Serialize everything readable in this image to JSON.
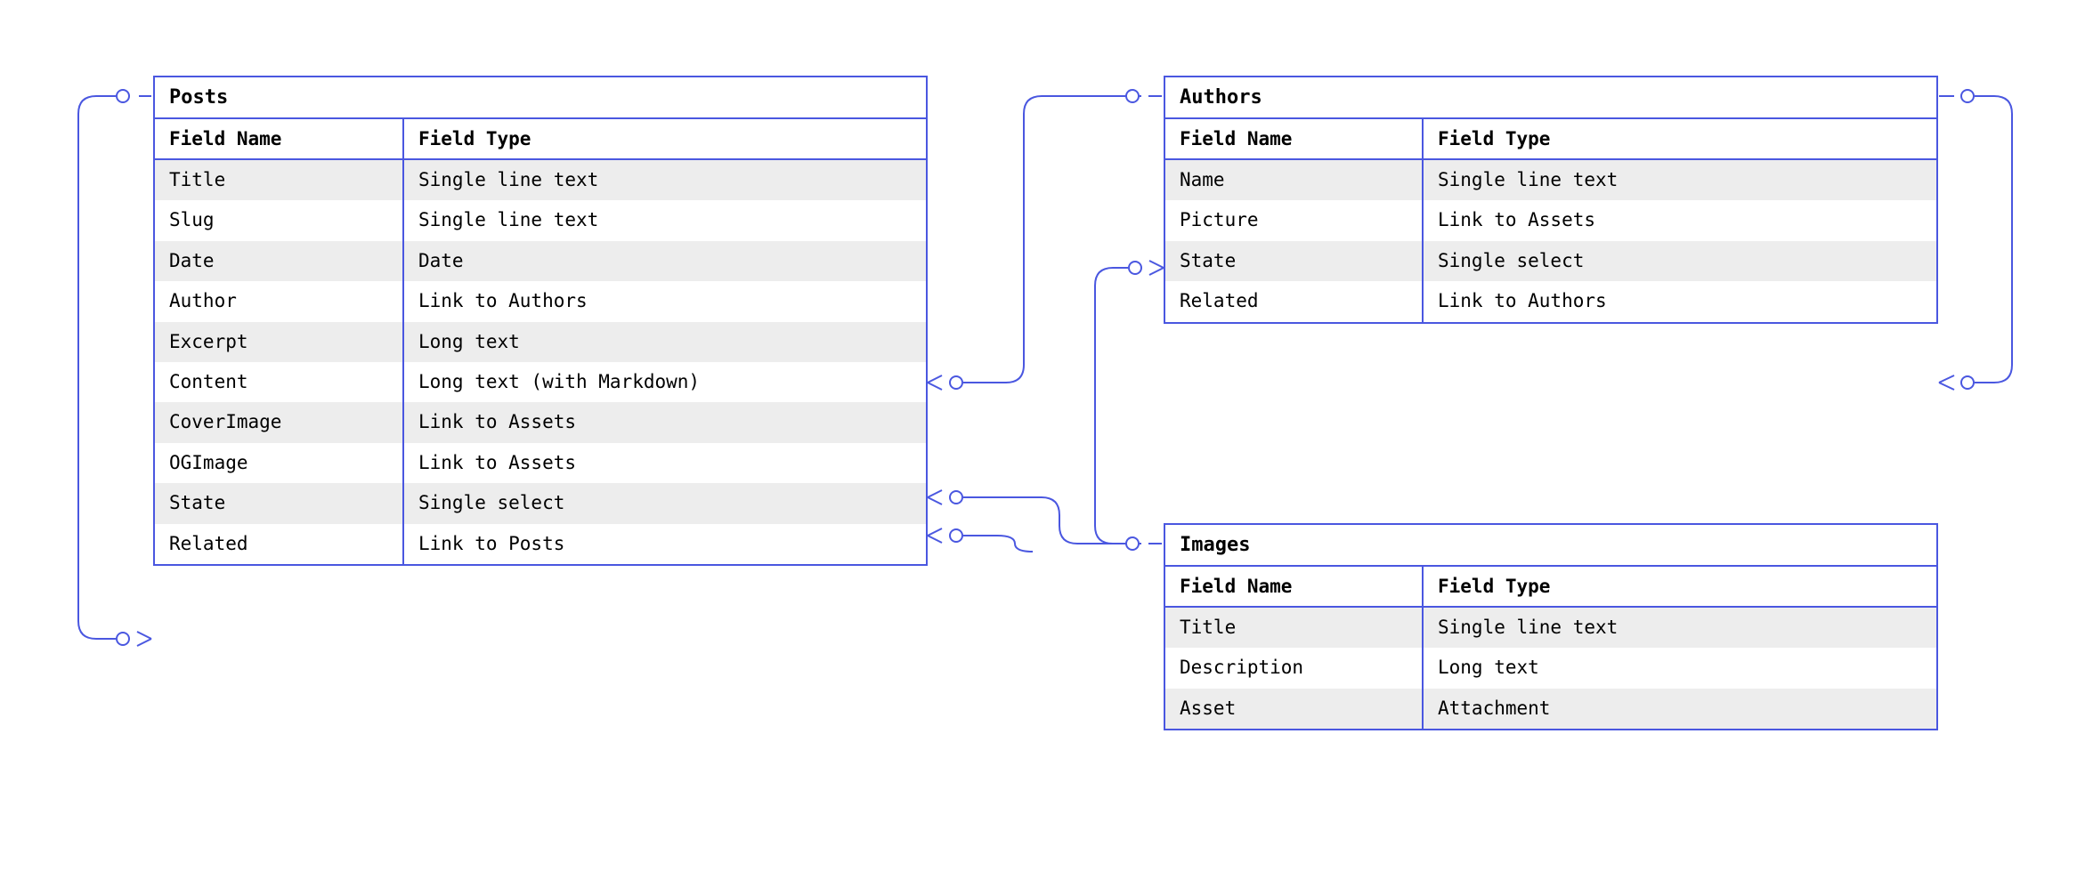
{
  "tables": {
    "posts": {
      "title": "Posts",
      "headers": {
        "name": "Field Name",
        "type": "Field Type"
      },
      "rows": [
        {
          "name": "Title",
          "type": "Single line text"
        },
        {
          "name": "Slug",
          "type": "Single line text"
        },
        {
          "name": "Date",
          "type": "Date"
        },
        {
          "name": "Author",
          "type": "Link to Authors"
        },
        {
          "name": "Excerpt",
          "type": "Long text"
        },
        {
          "name": "Content",
          "type": "Long text (with Markdown)"
        },
        {
          "name": "CoverImage",
          "type": "Link to Assets"
        },
        {
          "name": "OGImage",
          "type": "Link to Assets"
        },
        {
          "name": "State",
          "type": "Single select"
        },
        {
          "name": "Related",
          "type": "Link to Posts"
        }
      ]
    },
    "authors": {
      "title": "Authors",
      "headers": {
        "name": "Field Name",
        "type": "Field Type"
      },
      "rows": [
        {
          "name": "Name",
          "type": "Single line text"
        },
        {
          "name": "Picture",
          "type": "Link to Assets"
        },
        {
          "name": "State",
          "type": "Single select"
        },
        {
          "name": "Related",
          "type": "Link to Authors"
        }
      ]
    },
    "images": {
      "title": "Images",
      "headers": {
        "name": "Field Name",
        "type": "Field Type"
      },
      "rows": [
        {
          "name": "Title",
          "type": "Single line text"
        },
        {
          "name": "Description",
          "type": "Long text"
        },
        {
          "name": "Asset",
          "type": "Attachment"
        }
      ]
    }
  },
  "relationships": [
    {
      "from": "Posts.Author",
      "to": "Authors",
      "kind": "many-to-one"
    },
    {
      "from": "Posts.CoverImage",
      "to": "Images",
      "kind": "many-to-one"
    },
    {
      "from": "Posts.OGImage",
      "to": "Images",
      "kind": "many-to-one"
    },
    {
      "from": "Posts.Related",
      "to": "Posts",
      "kind": "self-many-to-one"
    },
    {
      "from": "Authors.Picture",
      "to": "Images",
      "kind": "many-to-one"
    },
    {
      "from": "Authors.Related",
      "to": "Authors",
      "kind": "self-many-to-one"
    }
  ],
  "colors": {
    "line": "#4a57e0",
    "zebra": "#ededed"
  }
}
